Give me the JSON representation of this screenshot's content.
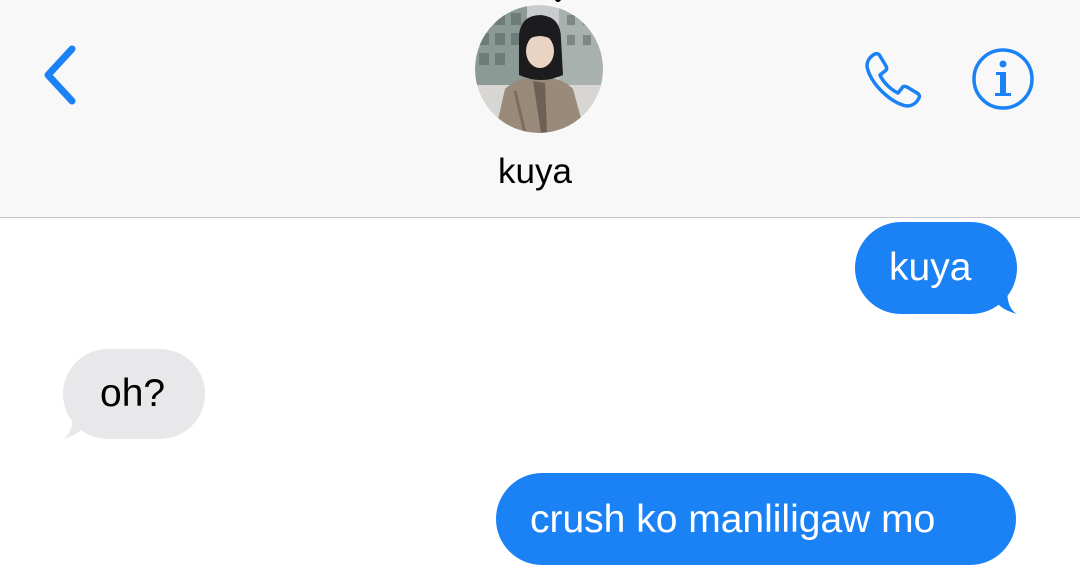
{
  "header": {
    "back_icon": "chevron-left-icon",
    "contact_name": "kuya",
    "call_icon": "phone-icon",
    "info_icon": "info-icon",
    "accent_color": "#1b82f5"
  },
  "messages": [
    {
      "direction": "sent",
      "text": "kuya"
    },
    {
      "direction": "received",
      "text": "oh?"
    },
    {
      "direction": "sent",
      "text": "crush ko manliligaw mo"
    }
  ],
  "colors": {
    "sent_bubble": "#1b82f5",
    "received_bubble": "#e8e8ea",
    "header_bg": "#f8f8f8"
  }
}
